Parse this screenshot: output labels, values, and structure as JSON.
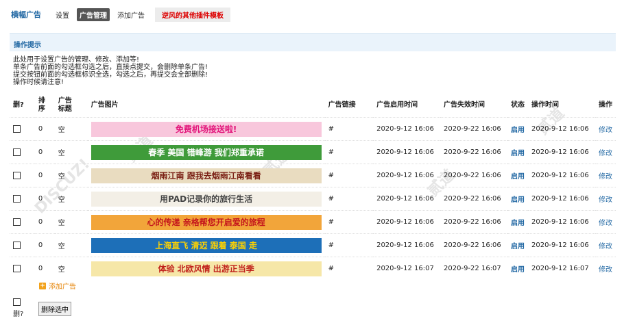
{
  "nav": {
    "brand": "横幅广告",
    "links": [
      "设置",
      "广告管理",
      "添加广告"
    ],
    "active_index": 1,
    "promo": "逆风的其他插件模板"
  },
  "tips": {
    "title": "操作提示",
    "lines": [
      "此处用于设置广告的管理、修改、添加等!",
      "单条广告前面的勾选框勾选之后，直接点提交，会删除单条广告!",
      "提交按钮前面的勾选框标识全选，勾选之后，再提交会全部删除!",
      "操作时候请注意!"
    ]
  },
  "table": {
    "headers": {
      "del": "删?",
      "order": "排序",
      "title": "广告标题",
      "image": "广告图片",
      "link": "广告链接",
      "start": "广告启用时间",
      "end": "广告失效时间",
      "status": "状态",
      "optime": "操作时间",
      "action": "操作"
    },
    "rows": [
      {
        "order": "0",
        "title": "空",
        "banner_text": "免费机场接送啦!",
        "banner_bg": "#f8c7dc",
        "banner_fg": "#e2147a",
        "link": "#",
        "start": "2020-9-12 16:06",
        "end": "2020-9-22 16:06",
        "status": "启用",
        "optime": "2020-9-12 16:06",
        "action": "修改"
      },
      {
        "order": "0",
        "title": "空",
        "banner_text": "春季 美国 错峰游  我们郑重承诺",
        "banner_bg": "#3f9b3a",
        "banner_fg": "#ffffff",
        "link": "#",
        "start": "2020-9-12 16:06",
        "end": "2020-9-22 16:06",
        "status": "启用",
        "optime": "2020-9-12 16:06",
        "action": "修改"
      },
      {
        "order": "0",
        "title": "空",
        "banner_text": "烟雨江南  跟我去烟雨江南看看",
        "banner_bg": "#e9dcc0",
        "banner_fg": "#7a1f14",
        "link": "#",
        "start": "2020-9-12 16:06",
        "end": "2020-9-22 16:06",
        "status": "启用",
        "optime": "2020-9-12 16:06",
        "action": "修改"
      },
      {
        "order": "0",
        "title": "空",
        "banner_text": "用PAD记录你的旅行生活",
        "banner_bg": "#f3efe6",
        "banner_fg": "#444444",
        "link": "#",
        "start": "2020-9-12 16:06",
        "end": "2020-9-22 16:06",
        "status": "启用",
        "optime": "2020-9-12 16:06",
        "action": "修改"
      },
      {
        "order": "0",
        "title": "空",
        "banner_text": "心的传递 亲格帮您开启爱的旅程",
        "banner_bg": "#f2a53a",
        "banner_fg": "#c4161c",
        "link": "#",
        "start": "2020-9-12 16:06",
        "end": "2020-9-22 16:06",
        "status": "启用",
        "optime": "2020-9-12 16:06",
        "action": "修改"
      },
      {
        "order": "0",
        "title": "空",
        "banner_text": "上海直飞 清迈 跟着 泰国 走",
        "banner_bg": "#1d6fb8",
        "banner_fg": "#ffd200",
        "link": "#",
        "start": "2020-9-12 16:06",
        "end": "2020-9-22 16:06",
        "status": "启用",
        "optime": "2020-9-12 16:06",
        "action": "修改"
      },
      {
        "order": "0",
        "title": "空",
        "banner_text": "体验 北欧风情 出游正当季",
        "banner_bg": "#f6e7a8",
        "banner_fg": "#c0201a",
        "link": "#",
        "start": "2020-9-12 16:07",
        "end": "2020-9-22 16:07",
        "status": "启用",
        "optime": "2020-9-12 16:07",
        "action": "修改"
      }
    ]
  },
  "add_label": "添加广告",
  "bottom": {
    "del_label": "删?",
    "delete_button": "删除选中"
  },
  "colors": {
    "accent": "#2369a4",
    "promo_red": "#dd0000",
    "add_orange": "#e6860a"
  }
}
